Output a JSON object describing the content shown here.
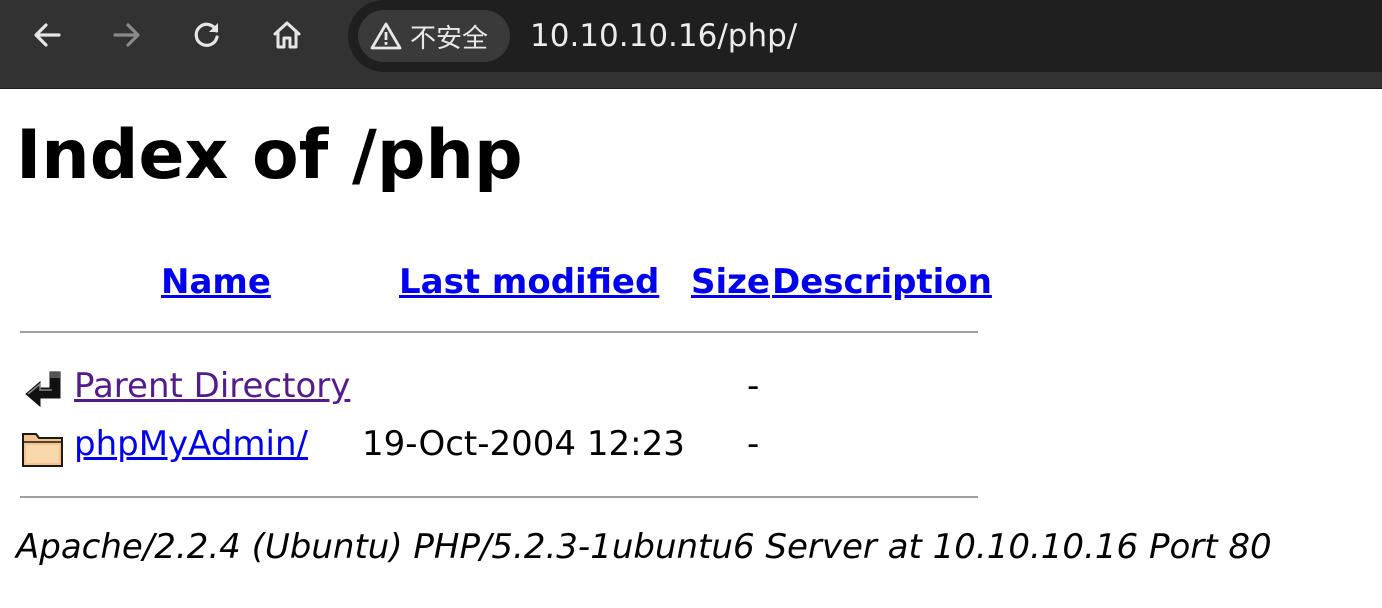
{
  "browser": {
    "security_label": "不安全",
    "url": "10.10.10.16/php/",
    "icons": {
      "back": "back-arrow-icon",
      "forward": "forward-arrow-icon",
      "reload": "reload-icon",
      "home": "home-icon",
      "warning": "warning-triangle-icon"
    },
    "colors": {
      "toolbar": "#323232",
      "omnibox": "#1f1f1f"
    }
  },
  "page": {
    "title": "Index of /php",
    "columns": {
      "name": "Name",
      "last_modified": "Last modified",
      "size": "Size",
      "description": "Description"
    },
    "rows": [
      {
        "icon": "back-arrow-icon",
        "name": "Parent Directory",
        "modified": "",
        "size": "-",
        "description": "",
        "visited": true
      },
      {
        "icon": "folder-icon",
        "name": "phpMyAdmin/",
        "modified": "19-Oct-2004 12:23",
        "size": "-",
        "description": "",
        "visited": false
      }
    ],
    "footer": "Apache/2.2.4 (Ubuntu) PHP/5.2.3-1ubuntu6 Server at 10.10.10.16 Port 80",
    "colors": {
      "link": "#0000ee",
      "visited_link": "#551a8b"
    }
  }
}
